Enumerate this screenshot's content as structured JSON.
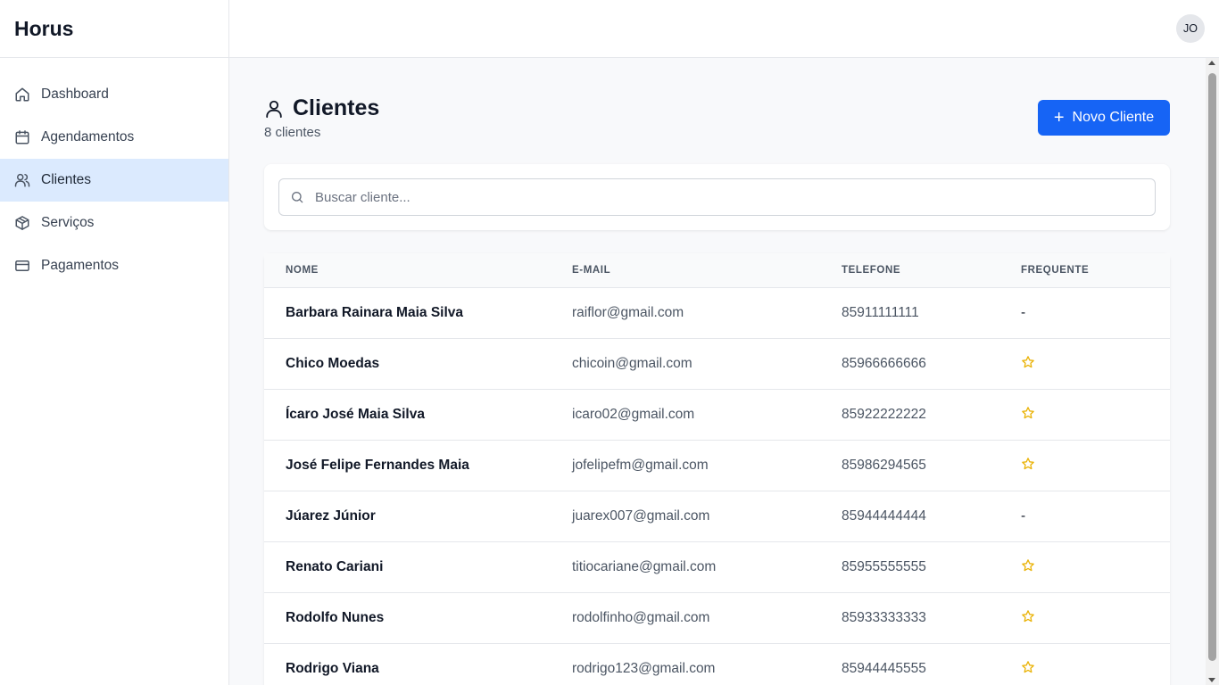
{
  "app": {
    "brand": "Horus"
  },
  "user": {
    "initials": "JO"
  },
  "sidebar": {
    "items": [
      {
        "label": "Dashboard",
        "icon": "home-icon",
        "active": false
      },
      {
        "label": "Agendamentos",
        "icon": "calendar-icon",
        "active": false
      },
      {
        "label": "Clientes",
        "icon": "users-icon",
        "active": true
      },
      {
        "label": "Serviços",
        "icon": "package-icon",
        "active": false
      },
      {
        "label": "Pagamentos",
        "icon": "credit-card-icon",
        "active": false
      }
    ]
  },
  "page": {
    "title": "Clientes",
    "title_icon": "user-icon",
    "subtitle": "8 clientes",
    "new_button": "Novo Cliente"
  },
  "search": {
    "placeholder": "Buscar cliente..."
  },
  "table": {
    "headers": [
      "NOME",
      "E-MAIL",
      "TELEFONE",
      "FREQUENTE"
    ],
    "rows": [
      {
        "nome": "Barbara Rainara Maia Silva",
        "email": "raiflor@gmail.com",
        "telefone": "85911111111",
        "frequente": false,
        "frequente_text": "-"
      },
      {
        "nome": "Chico Moedas",
        "email": "chicoin@gmail.com",
        "telefone": "85966666666",
        "frequente": true,
        "frequente_text": ""
      },
      {
        "nome": "Ícaro José Maia Silva",
        "email": "icaro02@gmail.com",
        "telefone": "85922222222",
        "frequente": true,
        "frequente_text": ""
      },
      {
        "nome": "José Felipe Fernandes Maia",
        "email": "jofelipefm@gmail.com",
        "telefone": "85986294565",
        "frequente": true,
        "frequente_text": ""
      },
      {
        "nome": "Júarez Júnior",
        "email": "juarex007@gmail.com",
        "telefone": "85944444444",
        "frequente": false,
        "frequente_text": "-"
      },
      {
        "nome": "Renato Cariani",
        "email": "titiocariane@gmail.com",
        "telefone": "85955555555",
        "frequente": true,
        "frequente_text": ""
      },
      {
        "nome": "Rodolfo Nunes",
        "email": "rodolfinho@gmail.com",
        "telefone": "85933333333",
        "frequente": true,
        "frequente_text": ""
      },
      {
        "nome": "Rodrigo Viana",
        "email": "rodrigo123@gmail.com",
        "telefone": "85944445555",
        "frequente": true,
        "frequente_text": ""
      }
    ]
  },
  "colors": {
    "accent": "#1664f5",
    "active_nav_bg": "#dbeafe",
    "star": "#eab308"
  }
}
